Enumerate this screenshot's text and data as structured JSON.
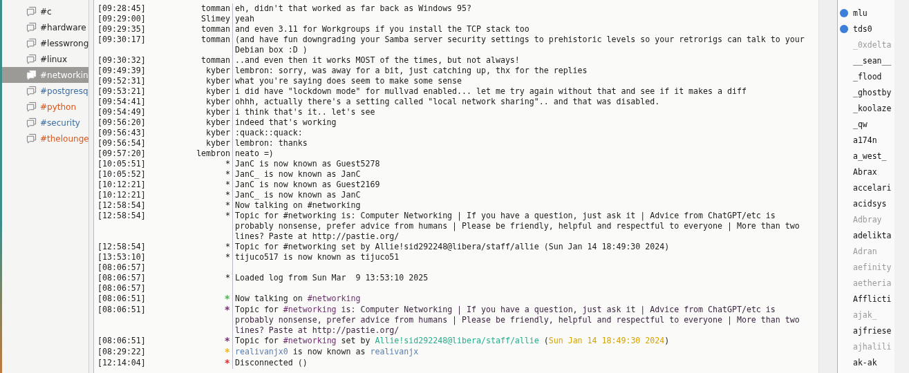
{
  "channels": [
    {
      "label": "#c",
      "color": "#222222",
      "selected": false
    },
    {
      "label": "#hardware",
      "color": "#222222",
      "selected": false
    },
    {
      "label": "#lesswrong",
      "color": "#222222",
      "selected": false
    },
    {
      "label": "#linux",
      "color": "#222222",
      "selected": false
    },
    {
      "label": "#networkin",
      "selected": true
    },
    {
      "label": "#postgresq",
      "color": "#3a6ea8",
      "selected": false
    },
    {
      "label": "#python",
      "color": "#d9561c",
      "selected": false
    },
    {
      "label": "#security",
      "color": "#3a6ea8",
      "selected": false
    },
    {
      "label": "#thelounge",
      "color": "#d9561c",
      "selected": false
    }
  ],
  "messages": [
    {
      "time": "[09:28:45]",
      "nick": "tomman",
      "segments": [
        {
          "text": "eh, didn't that worked as far back as Windows 95?"
        }
      ]
    },
    {
      "time": "[09:29:00]",
      "nick": "Slimey",
      "segments": [
        {
          "text": "yeah"
        }
      ]
    },
    {
      "time": "[09:29:35]",
      "nick": "tomman",
      "segments": [
        {
          "text": "and even 3.11 for Workgroups if you install the TCP stack too"
        }
      ]
    },
    {
      "time": "[09:30:17]",
      "nick": "tomman",
      "segments": [
        {
          "text": "(and have fun downgrading your Samba server security settings to prehistoric levels so your retrorigs can talk to your Debian box :D )"
        }
      ]
    },
    {
      "time": "[09:30:32]",
      "nick": "tomman",
      "segments": [
        {
          "text": "..and even then it works MOST of the times, but not always!"
        }
      ]
    },
    {
      "time": "[09:49:39]",
      "nick": "kyber",
      "segments": [
        {
          "text": "lembron: sorry, was away for a bit, just catching up, thx for the replies"
        }
      ]
    },
    {
      "time": "[09:52:31]",
      "nick": "kyber",
      "segments": [
        {
          "text": "what you're saying does seem to make some sense"
        }
      ]
    },
    {
      "time": "[09:53:21]",
      "nick": "kyber",
      "segments": [
        {
          "text": "i did have \"lockdown mode\" for mullvad enabled... let me try again without that and see if it makes a diff"
        }
      ]
    },
    {
      "time": "[09:54:41]",
      "nick": "kyber",
      "segments": [
        {
          "text": "ohhh, actually there's a setting called \"local network sharing\".. and that was disabled."
        }
      ]
    },
    {
      "time": "[09:54:49]",
      "nick": "kyber",
      "segments": [
        {
          "text": "i think that's it.. let's see"
        }
      ]
    },
    {
      "time": "[09:56:20]",
      "nick": "kyber",
      "segments": [
        {
          "text": "indeed that's working"
        }
      ]
    },
    {
      "time": "[09:56:43]",
      "nick": "kyber",
      "segments": [
        {
          "text": ":quack::quack:"
        }
      ]
    },
    {
      "time": "[09:56:54]",
      "nick": "kyber",
      "segments": [
        {
          "text": "lembron: thanks"
        }
      ]
    },
    {
      "time": "[09:57:20]",
      "nick": "lembron",
      "segments": [
        {
          "text": "neato =)"
        }
      ]
    },
    {
      "time": "[10:05:51]",
      "nick": "*",
      "segments": [
        {
          "text": "JanC is now known as Guest5278"
        }
      ]
    },
    {
      "time": "[10:05:52]",
      "nick": "*",
      "segments": [
        {
          "text": "JanC_ is now known as JanC"
        }
      ]
    },
    {
      "time": "[10:12:21]",
      "nick": "*",
      "segments": [
        {
          "text": "JanC is now known as Guest2169"
        }
      ]
    },
    {
      "time": "[10:12:21]",
      "nick": "*",
      "segments": [
        {
          "text": "JanC_ is now known as JanC"
        }
      ]
    },
    {
      "time": "[12:58:54]",
      "nick": "*",
      "segments": [
        {
          "text": "Now talking on #networking"
        }
      ]
    },
    {
      "time": "[12:58:54]",
      "nick": "*",
      "segments": [
        {
          "text": "Topic for #networking is: Computer Networking | If you have a question, just ask it | Advice from ChatGPT/etc is probably nonsense, prefer advice from humans | Please be friendly, helpful and respectful to everyone | More than two lines? Paste at http://pastie.org/"
        }
      ]
    },
    {
      "time": "[12:58:54]",
      "nick": "*",
      "segments": [
        {
          "text": "Topic for #networking set by Allie!sid292248@libera/staff/allie (Sun Jan 14 18:49:30 2024)"
        }
      ]
    },
    {
      "time": "[13:53:10]",
      "nick": "*",
      "segments": [
        {
          "text": "tijuco517 is now known as tijuco51"
        }
      ]
    },
    {
      "time": "[08:06:57]"
    },
    {
      "time": "[08:06:57]",
      "nick": "*",
      "segments": [
        {
          "text": "Loaded log from Sun Mar  9 13:53:10 2025"
        }
      ]
    },
    {
      "time": "[08:06:57]"
    },
    {
      "time": "[08:06:51]",
      "nick": "*",
      "color": "#4caf50",
      "segments": [
        {
          "text": "Now talking on "
        },
        {
          "text": "#networking",
          "color": "#6b2e6b"
        }
      ]
    },
    {
      "time": "[08:06:51]",
      "nick": "*",
      "color": "#6b2e6b",
      "segments": [
        {
          "text": "Topic for "
        },
        {
          "text": "#networking",
          "color": "#6b2e6b"
        },
        {
          "text": " is: Computer Networking | If you have a question, just ask it | Advice from ChatGPT/etc is probably nonsense, prefer advice from humans | Please be friendly, helpful and respectful to everyone | More than two lines? Paste at http://pastie.org/",
          "color": "#3c2540"
        }
      ]
    },
    {
      "time": "[08:06:51]",
      "nick": "*",
      "color": "#6b2e6b",
      "segments": [
        {
          "text": "Topic for "
        },
        {
          "text": "#networking",
          "color": "#6b2e6b"
        },
        {
          "text": " set by "
        },
        {
          "text": "Allie!sid292248@libera/staff/allie",
          "color": "#27ae8e"
        },
        {
          "text": " ("
        },
        {
          "text": "Sun Jan 14 18:49:30 2024",
          "color": "#d4a400"
        },
        {
          "text": ")"
        }
      ]
    },
    {
      "time": "[08:29:22]",
      "nick": "*",
      "color": "#e6b422",
      "segments": [
        {
          "text": "realivanjx0",
          "color": "#5a7fb0"
        },
        {
          "text": " is now known as "
        },
        {
          "text": "realivanjx",
          "color": "#5a7fb0"
        }
      ]
    },
    {
      "time": "[12:14:04]",
      "nick": "*",
      "color": "#d32f2f",
      "segments": [
        {
          "text": "Disconnected ()"
        }
      ]
    }
  ],
  "users": [
    {
      "name": "mlu",
      "voiced": true,
      "away": false
    },
    {
      "name": "tds0",
      "voiced": true,
      "away": false
    },
    {
      "name": "_0xdelta",
      "voiced": false,
      "away": true
    },
    {
      "name": "__sean__",
      "voiced": false,
      "away": false
    },
    {
      "name": "_flood",
      "voiced": false,
      "away": false
    },
    {
      "name": "_ghostby",
      "voiced": false,
      "away": false
    },
    {
      "name": "_koolaze",
      "voiced": false,
      "away": false
    },
    {
      "name": "_qw",
      "voiced": false,
      "away": false
    },
    {
      "name": "a174n",
      "voiced": false,
      "away": false
    },
    {
      "name": "a_west_",
      "voiced": false,
      "away": false
    },
    {
      "name": "Abrax",
      "voiced": false,
      "away": false
    },
    {
      "name": "accelari",
      "voiced": false,
      "away": false
    },
    {
      "name": "acidsys",
      "voiced": false,
      "away": false
    },
    {
      "name": "Adbray",
      "voiced": false,
      "away": true
    },
    {
      "name": "adelikta",
      "voiced": false,
      "away": false
    },
    {
      "name": "Adran",
      "voiced": false,
      "away": true
    },
    {
      "name": "aefinity",
      "voiced": false,
      "away": true
    },
    {
      "name": "aetheria",
      "voiced": false,
      "away": true
    },
    {
      "name": "Afflicti",
      "voiced": false,
      "away": false
    },
    {
      "name": "ajak_",
      "voiced": false,
      "away": true
    },
    {
      "name": "ajfriese",
      "voiced": false,
      "away": false
    },
    {
      "name": "ajhalili",
      "voiced": false,
      "away": true
    },
    {
      "name": "ak-ak",
      "voiced": false,
      "away": false
    }
  ]
}
